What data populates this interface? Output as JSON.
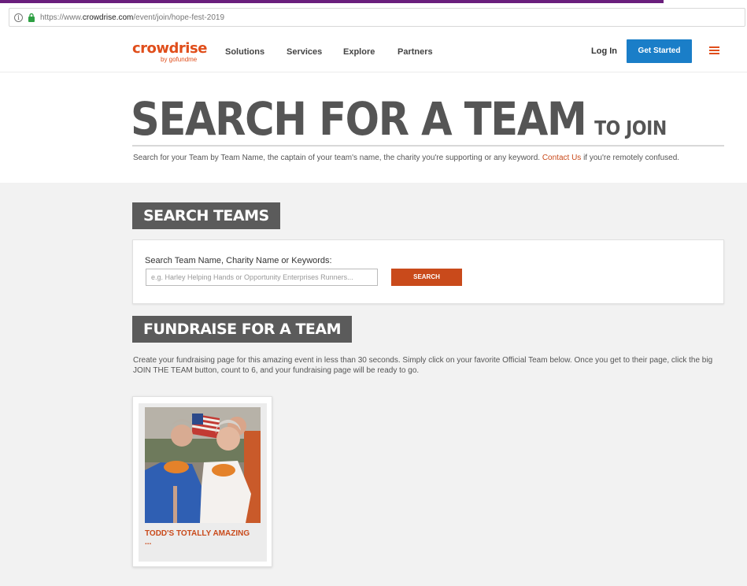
{
  "browser": {
    "url_prefix": "https://www.",
    "url_host": "crowdrise.com",
    "url_path": "/event/join/hope-fest-2019"
  },
  "header": {
    "logo_main": "crowdrise",
    "logo_sub": "by gofundme",
    "nav": [
      "Solutions",
      "Services",
      "Explore",
      "Partners"
    ],
    "login_label": "Log In",
    "cta_label": "Get Started",
    "menu_icon": "hamburger-icon",
    "accent_color": "#e04e1b",
    "cta_color": "#1a7ec8"
  },
  "hero": {
    "title": "SEARCH FOR A TEAM",
    "title_suffix": "TO JOIN",
    "desc_before": "Search for your Team by Team Name, the captain of your team's name, the charity you're supporting or any keyword. ",
    "desc_link": "Contact Us",
    "desc_after": " if you're remotely confused."
  },
  "search_section": {
    "heading": "SEARCH TEAMS",
    "label": "Search Team Name, Charity Name or Keywords:",
    "placeholder": "e.g. Harley Helping Hands or Opportunity Enterprises Runners...",
    "value": "",
    "button_label": "SEARCH"
  },
  "fundraise_section": {
    "heading": "FUNDRAISE FOR A TEAM",
    "description": "Create your fundraising page for this amazing event in less than 30 seconds. Simply click on your favorite Official Team below. Once you get to their page, click the big JOIN THE TEAM button, count to 6, and your fundraising page will be ready to go.",
    "teams": [
      {
        "name": "TODD'S TOTALLY AMAZING",
        "more": "...",
        "photo": "team-photo"
      }
    ]
  }
}
